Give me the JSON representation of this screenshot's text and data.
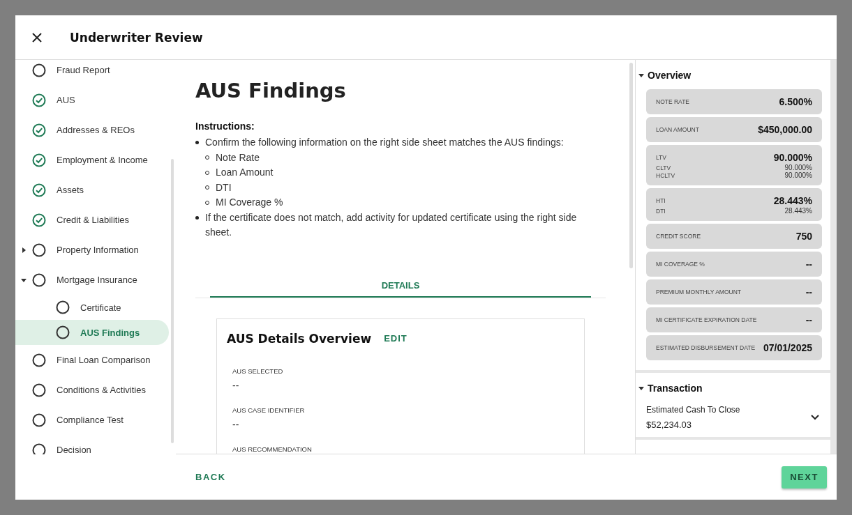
{
  "dialog": {
    "title": "Underwriter Review"
  },
  "sidebar": {
    "items": [
      {
        "label": "Fraud Report",
        "completed": false,
        "selected": false
      },
      {
        "label": "AUS",
        "completed": true,
        "selected": false
      },
      {
        "label": "Addresses & REOs",
        "completed": true,
        "selected": false
      },
      {
        "label": "Employment & Income",
        "completed": true,
        "selected": false
      },
      {
        "label": "Assets",
        "completed": true,
        "selected": false
      },
      {
        "label": "Credit & Liabilities",
        "completed": true,
        "selected": false
      },
      {
        "label": "Property Information",
        "completed": false,
        "selected": false,
        "expanded": false
      },
      {
        "label": "Mortgage Insurance",
        "completed": false,
        "selected": false,
        "expanded": true,
        "children": [
          {
            "label": "Certificate",
            "completed": false,
            "selected": false
          },
          {
            "label": "AUS Findings",
            "completed": false,
            "selected": true
          }
        ]
      },
      {
        "label": "Final Loan Comparison",
        "completed": false,
        "selected": false
      },
      {
        "label": "Conditions & Activities",
        "completed": false,
        "selected": false
      },
      {
        "label": "Compliance Test",
        "completed": false,
        "selected": false
      },
      {
        "label": "Decision",
        "completed": false,
        "selected": false
      }
    ]
  },
  "main": {
    "title": "AUS Findings",
    "instructions_heading": "Instructions:",
    "instructions": [
      {
        "text": "Confirm the following information on the right side sheet matches the AUS findings:",
        "children": [
          "Note Rate",
          "Loan Amount",
          "DTI",
          "MI Coverage %"
        ]
      },
      {
        "text": "If the certificate does not match, add activity for updated certificate using the right side sheet."
      }
    ],
    "tabs": [
      {
        "label": "DETAILS",
        "selected": true
      }
    ],
    "card": {
      "title": "AUS Details Overview",
      "edit": "EDIT",
      "fields": [
        {
          "label": "AUS SELECTED",
          "value": "--"
        },
        {
          "label": "AUS CASE IDENTIFIER",
          "value": "--"
        },
        {
          "label": "AUS RECOMMENDATION"
        }
      ]
    }
  },
  "side_sheet": {
    "sections": [
      {
        "title": "Overview",
        "expanded": true,
        "kind": "tiles",
        "tiles": [
          {
            "rows": [
              {
                "label": "NOTE RATE",
                "value": "6.500%",
                "primary": true
              }
            ]
          },
          {
            "rows": [
              {
                "label": "LOAN AMOUNT",
                "value": "$450,000.00",
                "primary": true
              }
            ]
          },
          {
            "rows": [
              {
                "label": "LTV",
                "value": "90.000%",
                "primary": true
              },
              {
                "label": "CLTV",
                "value": "90.000%",
                "primary": false
              },
              {
                "label": "HCLTV",
                "value": "90.000%",
                "primary": false
              }
            ]
          },
          {
            "rows": [
              {
                "label": "HTI",
                "value": "28.443%",
                "primary": true
              },
              {
                "label": "DTI",
                "value": "28.443%",
                "primary": false
              }
            ]
          },
          {
            "rows": [
              {
                "label": "CREDIT SCORE",
                "value": "750",
                "primary": true
              }
            ]
          },
          {
            "rows": [
              {
                "label": "MI COVERAGE %",
                "value": "--",
                "primary": true
              }
            ]
          },
          {
            "rows": [
              {
                "label": "PREMIUM MONTHLY AMOUNT",
                "value": "--",
                "primary": true
              }
            ]
          },
          {
            "rows": [
              {
                "label": "MI CERTIFICATE EXPIRATION DATE",
                "value": "--",
                "primary": true
              }
            ]
          },
          {
            "rows": [
              {
                "label": "ESTIMATED DISBURSEMENT DATE",
                "value": "07/01/2025",
                "primary": true
              }
            ]
          }
        ]
      },
      {
        "title": "Transaction",
        "expanded": true,
        "kind": "list",
        "items": [
          {
            "label": "Estimated Cash To Close",
            "value": "$52,234.03",
            "expanded": false
          }
        ]
      }
    ]
  },
  "footer": {
    "back": "BACK",
    "next": "NEXT"
  }
}
